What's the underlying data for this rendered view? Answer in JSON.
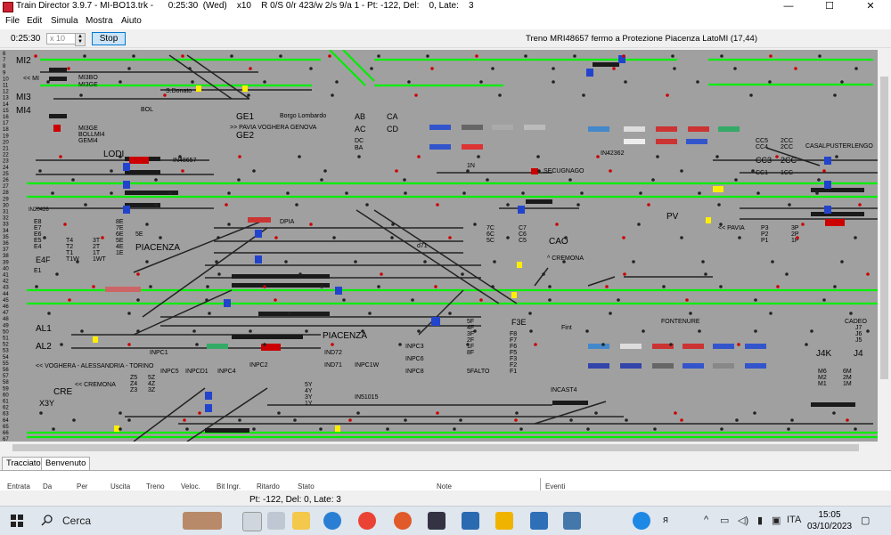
{
  "window": {
    "title": "Train Director 3.9.7 - MI-BO13.trk -      0:25:30  (Wed)    x10    R 0/S 0/r 423/w 2/s 9/a 1 - Pt: -122, Del:    0, Late:    3",
    "minimize": "—",
    "maximize": "☐",
    "close": "✕"
  },
  "menu": {
    "file": "File",
    "edit": "Edit",
    "simula": "Simula",
    "mostra": "Mostra",
    "aiuto": "Aiuto"
  },
  "toolbar": {
    "clock": "0:25:30",
    "speed": "x 10",
    "stop": "Stop",
    "message": "Treno MRI48657 fermo a Protezione Piacenza LatoMI (17,44)"
  },
  "row_numbers": [
    "6",
    "7",
    "8",
    "9",
    "10",
    "11",
    "12",
    "13",
    "14",
    "15",
    "16",
    "17",
    "18",
    "19",
    "20",
    "21",
    "22",
    "23",
    "24",
    "25",
    "26",
    "27",
    "28",
    "29",
    "30",
    "31",
    "32",
    "33",
    "34",
    "35",
    "36",
    "37",
    "38",
    "39",
    "40",
    "41",
    "42",
    "43",
    "44",
    "45",
    "46",
    "47",
    "48",
    "49",
    "50",
    "51",
    "52",
    "53",
    "54",
    "55",
    "56",
    "57",
    "58",
    "59",
    "60",
    "61",
    "62",
    "63",
    "64",
    "65",
    "66",
    "67",
    "68"
  ],
  "labels": {
    "mi2": "MI2",
    "mi": "<< MI",
    "mi3": "MI3",
    "mi4": "MI4",
    "mi3bo": "MI3BO",
    "mi3ge": "MI3GE",
    "mi3ge_b": "MI3GE",
    "bollmi4": "BOLLMI4",
    "gemi4": "GEMI4",
    "sdonato": "S.Donato",
    "bol": "BOL",
    "ge1": "GE1",
    "ge2": "GE2",
    "borgo": "Borgo Lombardo",
    "pavia_vog": ">> PAVIA VOGHERA GENOVA",
    "ab": "AB",
    "ca": "CA",
    "ac": "AC",
    "cd": "CD",
    "dc": "DC",
    "ba": "BA",
    "lodi": "LODI",
    "in48657": "IN48657",
    "n1": "1N",
    "secugnago": "SECUGNAGO",
    "in42362": "IN42362",
    "cc5": "CC5",
    "cc4": "CC4",
    "cc3": "CC3",
    "cc1": "CC1",
    "c2cc_a": "2CC",
    "c2cc_b": "2CC",
    "c2cc_c": "2CC",
    "c1cc": "1CC",
    "casalp": "CASALPUSTERLENGO",
    "in20426": "IN20426",
    "dpia": "DPIA",
    "pv": "PV",
    "pavia": "<< PAVIA",
    "p3": "P3",
    "p2": "P2",
    "p1": "P1",
    "p3b": "3P",
    "p2b": "2P",
    "p1b": "1P",
    "e8": "E8",
    "e7": "E7",
    "e6": "E6",
    "e5": "E5",
    "e4": "E4",
    "e1": "E1",
    "e4f": "E4F",
    "e8b": "8E",
    "e7b": "7E",
    "e6b": "6E",
    "e5b": "5E",
    "e4b": "4E",
    "e1b": "1E",
    "e5e": "5E",
    "t4": "T4",
    "t2": "T2",
    "t1": "T1",
    "t1w": "T1W",
    "t3b": "3T",
    "t2b": "2T",
    "t1b": "1T",
    "t1wb": "1WT",
    "piacenza": "PIACENZA",
    "piacenza2": "PIACENZA",
    "c7c": "7C",
    "c6c": "6C",
    "c5c": "5C",
    "c7": "C7",
    "c6": "C6",
    "c5": "C5",
    "d71": "d71",
    "cao": "CAO",
    "cremona": "^ CREMONA",
    "al1": "AL1",
    "al2": "AL2",
    "vog_al_tor": "<< VOGHERA - ALESSANDRIA - TORINO",
    "inpc1": "INPC1",
    "inpc5": "INPC5",
    "inpcd1": "INPCD1",
    "inpc4": "INPC4",
    "inpc2": "INPC2",
    "ind72": "IND72",
    "ind71": "IND71",
    "inpc1w": "INPC1W",
    "inpc3": "INPC3",
    "inpc6": "INPC6",
    "inpc8": "INPC8",
    "f3e": "F3E",
    "fint": "Fint",
    "f5falto": "5FALTO",
    "f8": "F8",
    "f7": "F7",
    "f6": "F6",
    "f5": "F5",
    "f2": "F2",
    "f3": "F3",
    "f1": "F1",
    "f5b": "5F",
    "f4b": "4F",
    "f3b": "3F",
    "f2b": "2F",
    "f1b": "1F",
    "f8b": "8F",
    "fontenure": "FONTENURE",
    "cadeo": "CADEO",
    "j4k": "J4K",
    "j4": "J4",
    "j7": "J7",
    "j6": "J6",
    "j5": "J5",
    "m6": "M6",
    "m2": "M2",
    "m1": "M1",
    "m6b": "6M",
    "m2b": "2M",
    "m1b": "1M",
    "cre": "CRE",
    "cremona2": "<< CREMONA",
    "x3y": "X3Y",
    "z5": "Z5",
    "z4": "Z4",
    "z3": "Z3",
    "z5b": "5Z",
    "z4b": "4Z",
    "z3b": "3Z",
    "y5": "5Y",
    "y4": "4Y",
    "y3": "3Y",
    "y1": "1Y",
    "in51015": "IN51015",
    "incast4": "INCAST4"
  },
  "bottom": {
    "tab_tracciato": "Tracciato",
    "tab_benvenuto": "Benvenuto",
    "columns": [
      "Entrata",
      "Da",
      "Per",
      "Uscita",
      "Treno",
      "Veloc.",
      "Bit Ingr.",
      "Ritardo",
      "Stato",
      "Note"
    ],
    "eventi": "Eventi",
    "status": "Pt: -122, Del:    0, Late:    3"
  },
  "taskbar": {
    "search": "Cerca",
    "lang": "ITA",
    "time": "15:05",
    "date": "03/10/2023"
  },
  "colors": {
    "canvas": "#a0a0a0",
    "track": "#00ee00",
    "track_dark": "#222222",
    "signal_red": "#cc0000",
    "route_blue": "#2244cc"
  }
}
